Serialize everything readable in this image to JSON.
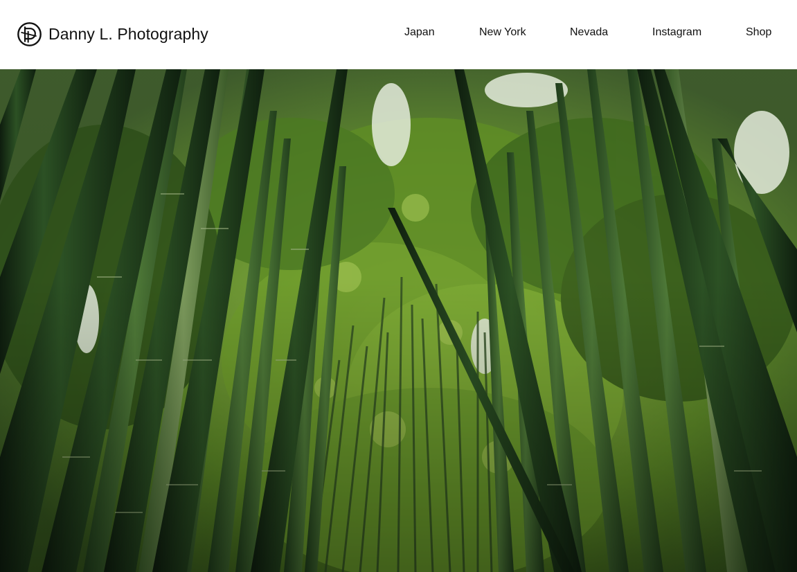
{
  "header": {
    "brand_name": "Danny L. Photography",
    "logo_icon": "aperture-camera-logo-icon"
  },
  "nav": {
    "items": [
      {
        "label": "Japan"
      },
      {
        "label": "New York"
      },
      {
        "label": "Nevada"
      },
      {
        "label": "Instagram"
      },
      {
        "label": "Shop"
      }
    ]
  },
  "hero": {
    "image_subject": "bamboo forest photo",
    "colors": {
      "sky": "#dfe6d6",
      "canopy": "#4e7d22",
      "canopy_light": "#8fb53f",
      "stalk_dark": "#1a3318",
      "stalk_mid": "#2f5a25"
    }
  }
}
